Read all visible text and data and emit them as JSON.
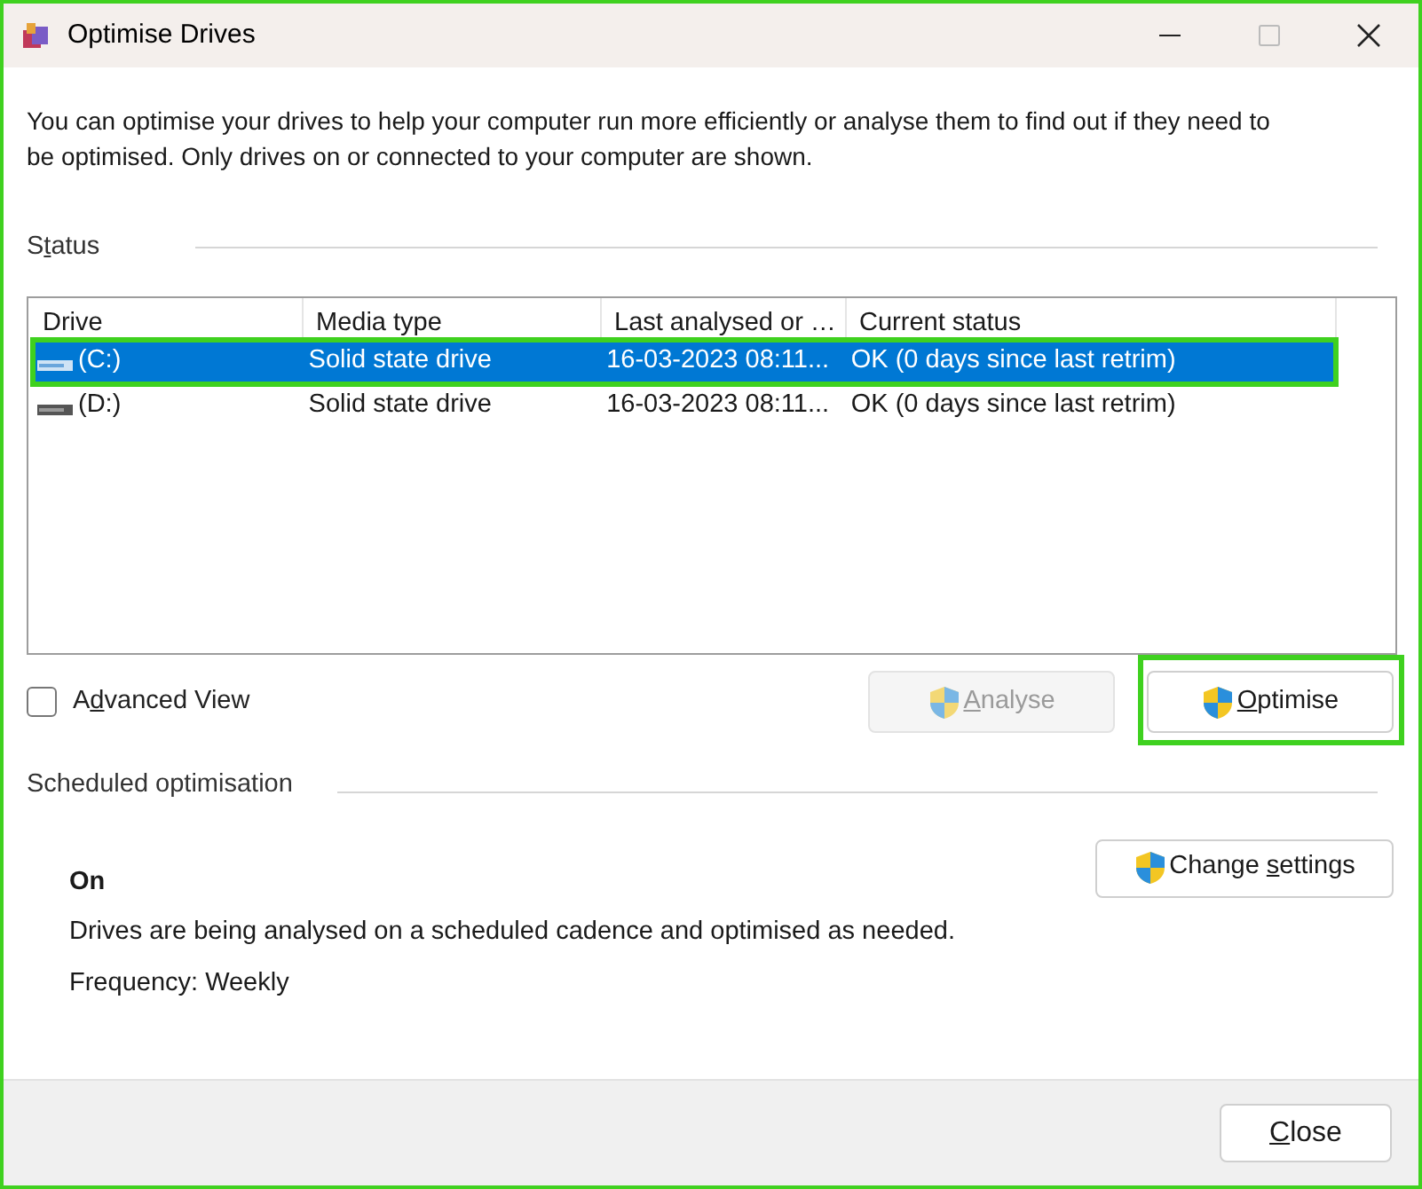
{
  "window": {
    "title": "Optimise Drives"
  },
  "description": "You can optimise your drives to help your computer run more efficiently or analyse them to find out if they need to be optimised. Only drives on or connected to your computer are shown.",
  "status_section": {
    "label": {
      "before": "S",
      "key": "t",
      "after": "atus"
    }
  },
  "table": {
    "columns": [
      "Drive",
      "Media type",
      "Last analysed or …",
      "Current status"
    ],
    "rows": [
      {
        "drive": "(C:)",
        "media_type": "Solid state drive",
        "last_analysed": "16-03-2023 08:11...",
        "current_status": "OK (0 days since last retrim)",
        "selected": true,
        "highlighted": true
      },
      {
        "drive": "(D:)",
        "media_type": "Solid state drive",
        "last_analysed": "16-03-2023 08:11...",
        "current_status": "OK (0 days since last retrim)",
        "selected": false,
        "highlighted": false
      }
    ]
  },
  "advanced_view": {
    "label": {
      "before": "A",
      "key": "d",
      "after": "vanced View"
    },
    "checked": false
  },
  "action_buttons": [
    {
      "label": {
        "key": "A",
        "after": "nalyse"
      },
      "disabled": true,
      "highlighted": false
    },
    {
      "label": {
        "key": "O",
        "after": "ptimise"
      },
      "disabled": false,
      "highlighted": true
    }
  ],
  "scheduled": {
    "heading": "Scheduled optimisation",
    "state": "On",
    "description": "Drives are being analysed on a scheduled cadence and optimised as needed.",
    "frequency": "Frequency: Weekly",
    "button": {
      "before": "Change ",
      "key": "s",
      "after": "ettings"
    }
  },
  "footer": {
    "close_button": {
      "key": "C",
      "after": "lose"
    }
  }
}
